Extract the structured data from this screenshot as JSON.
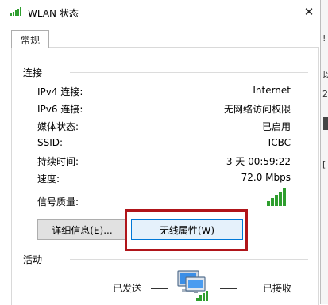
{
  "window": {
    "title": "WLAN 状态"
  },
  "tabs": [
    {
      "label": "常规"
    }
  ],
  "connection": {
    "group_label": "连接",
    "rows": [
      {
        "label": "IPv4 连接:",
        "value": "Internet"
      },
      {
        "label": "IPv6 连接:",
        "value": "无网络访问权限"
      },
      {
        "label": "媒体状态:",
        "value": "已启用"
      },
      {
        "label": "SSID:",
        "value": "ICBC"
      },
      {
        "label": "持续时间:",
        "value": "3 天 00:59:22"
      },
      {
        "label": "速度:",
        "value": "72.0 Mbps"
      }
    ],
    "signal_label": "信号质量:",
    "signal_bars": 5,
    "details_button": "详细信息(E)...",
    "wireless_button": "无线属性(W)"
  },
  "activity": {
    "group_label": "活动",
    "sent_label": "已发送",
    "received_label": "已接收"
  },
  "colors": {
    "highlight": "#b0151a",
    "signal": "#2e9e2e",
    "accent": "#0078d7"
  },
  "icons": [
    "wifi-signal-icon",
    "close-icon",
    "signal-strength-icon",
    "network-computer-icon"
  ]
}
